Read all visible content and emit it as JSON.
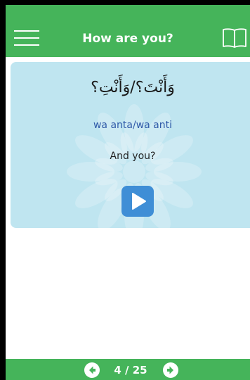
{
  "header": {
    "title": "How are you?",
    "menu_icon": "hamburger-menu-icon",
    "book_icon": "book-icon"
  },
  "card": {
    "arabic": "وَأَنْتَ؟/وَأَنْتِ؟",
    "transliteration": "wa anta/wa anti",
    "translation": "And you?",
    "play_icon": "play-icon"
  },
  "pager": {
    "counter": "4 / 25",
    "prev_icon": "arrow-left-circle-icon",
    "next_icon": "arrow-right-circle-icon"
  },
  "colors": {
    "brand_green": "#45b45a",
    "card_bg": "#bfe5f0",
    "play_button": "#3f8ed6",
    "transliteration_text": "#2e59a8"
  }
}
